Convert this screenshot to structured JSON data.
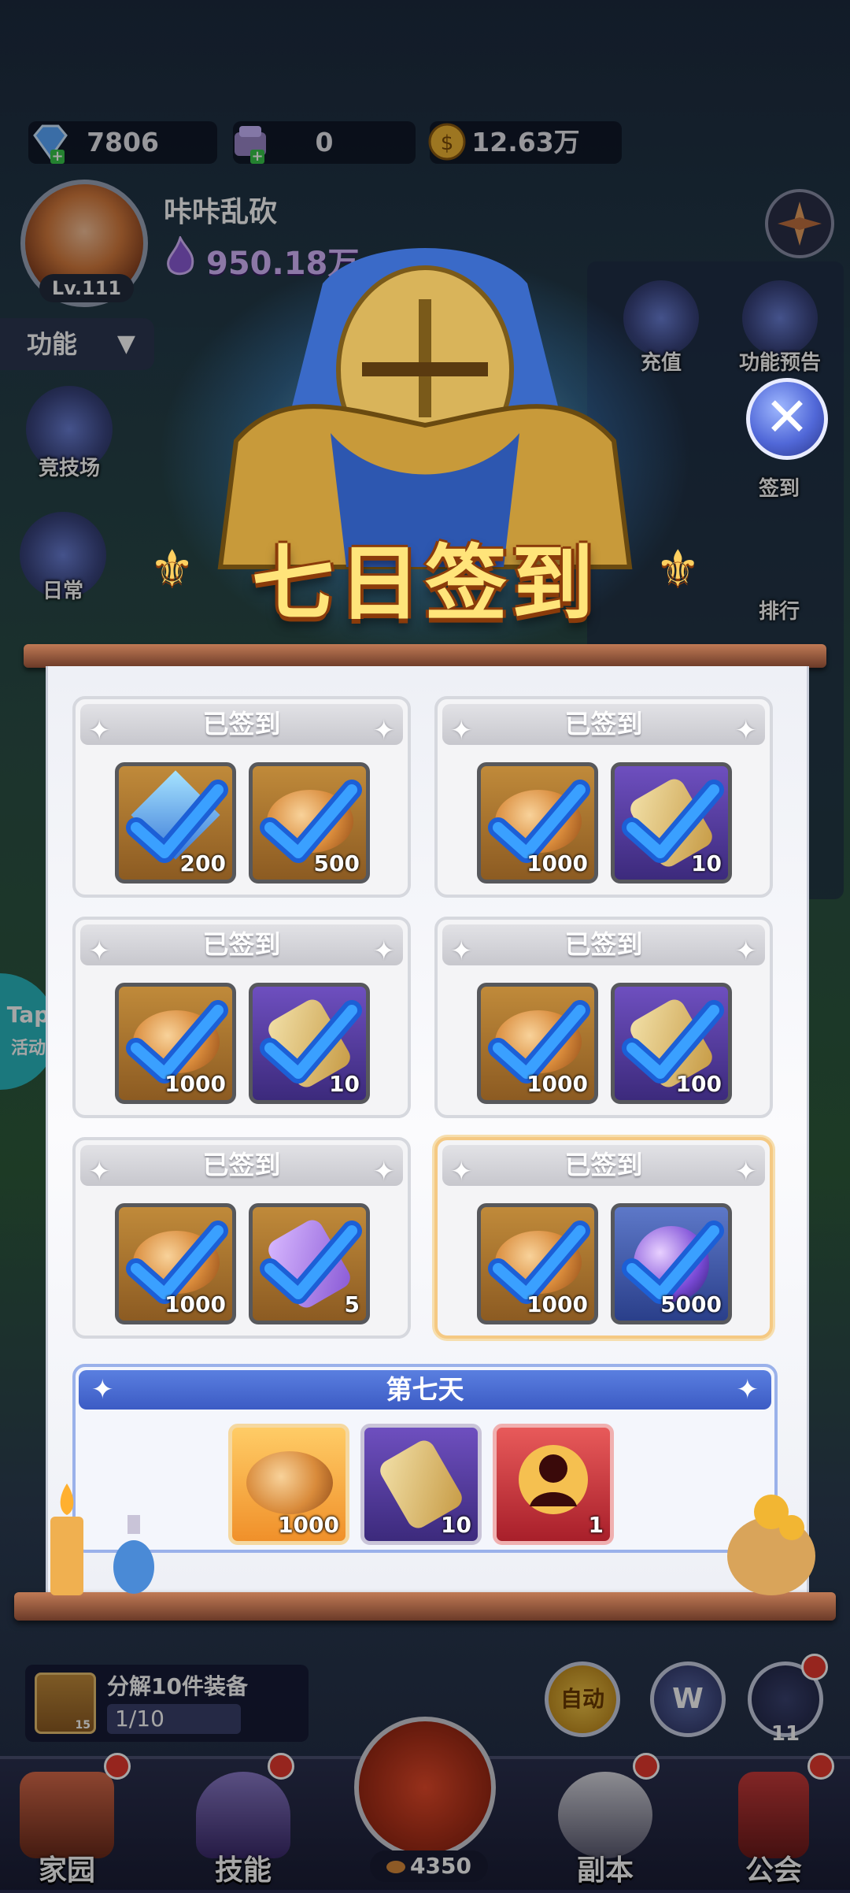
{
  "resources": [
    {
      "icon": "diamond-icon",
      "value": "7806"
    },
    {
      "icon": "gem-box-icon",
      "value": "0"
    },
    {
      "icon": "coin-icon",
      "value": "12.63万"
    }
  ],
  "player": {
    "name": "咔咔乱砍",
    "level": "Lv.111",
    "power": "950.18万"
  },
  "function_menu": {
    "label": "功能"
  },
  "side_left": [
    {
      "label": "竞技场",
      "icon": "arena-icon"
    },
    {
      "label": "日常",
      "icon": "daily-icon"
    }
  ],
  "side_right": [
    {
      "label": "充值",
      "icon": "recharge-icon"
    },
    {
      "label": "功能预告",
      "icon": "preview-scroll-icon"
    },
    {
      "label": "签到",
      "icon": "signin-icon"
    },
    {
      "label": "排行",
      "icon": "ranking-icon"
    }
  ],
  "tap_event": {
    "line1": "Tap",
    "line2": "活动"
  },
  "popup": {
    "title": "七日签到",
    "close_symbol": "✕",
    "days": [
      {
        "status": "已签到",
        "items": [
          {
            "kind": "gem",
            "qty": "200"
          },
          {
            "kind": "bread",
            "qty": "500"
          }
        ]
      },
      {
        "status": "已签到",
        "items": [
          {
            "kind": "bread",
            "qty": "1000"
          },
          {
            "kind": "scroll",
            "qty": "10"
          }
        ]
      },
      {
        "status": "已签到",
        "items": [
          {
            "kind": "bread",
            "qty": "1000"
          },
          {
            "kind": "scroll",
            "qty": "10"
          }
        ]
      },
      {
        "status": "已签到",
        "items": [
          {
            "kind": "bread",
            "qty": "1000"
          },
          {
            "kind": "scroll",
            "qty": "100"
          }
        ]
      },
      {
        "status": "已签到",
        "items": [
          {
            "kind": "bread",
            "qty": "1000"
          },
          {
            "kind": "key",
            "qty": "5"
          }
        ]
      },
      {
        "status": "已签到",
        "items": [
          {
            "kind": "bread",
            "qty": "1000"
          },
          {
            "kind": "orb",
            "qty": "5000"
          }
        ]
      }
    ],
    "day7": {
      "title": "第七天",
      "items": [
        {
          "kind": "bread",
          "qty": "1000"
        },
        {
          "kind": "scroll",
          "qty": "10"
        },
        {
          "kind": "hero-shard",
          "qty": "1"
        }
      ]
    }
  },
  "quest": {
    "text": "分解10件装备",
    "progress": "1/10",
    "item_qty": "15"
  },
  "bottom_buttons": {
    "auto": "自动",
    "w": "W",
    "target_count": "11"
  },
  "nav": [
    {
      "label": "家园",
      "icon": "home-icon"
    },
    {
      "label": "技能",
      "icon": "skill-icon"
    },
    {
      "label": "4350",
      "icon": "battle-icon"
    },
    {
      "label": "副本",
      "icon": "dungeon-icon"
    },
    {
      "label": "公会",
      "icon": "guild-icon"
    }
  ]
}
